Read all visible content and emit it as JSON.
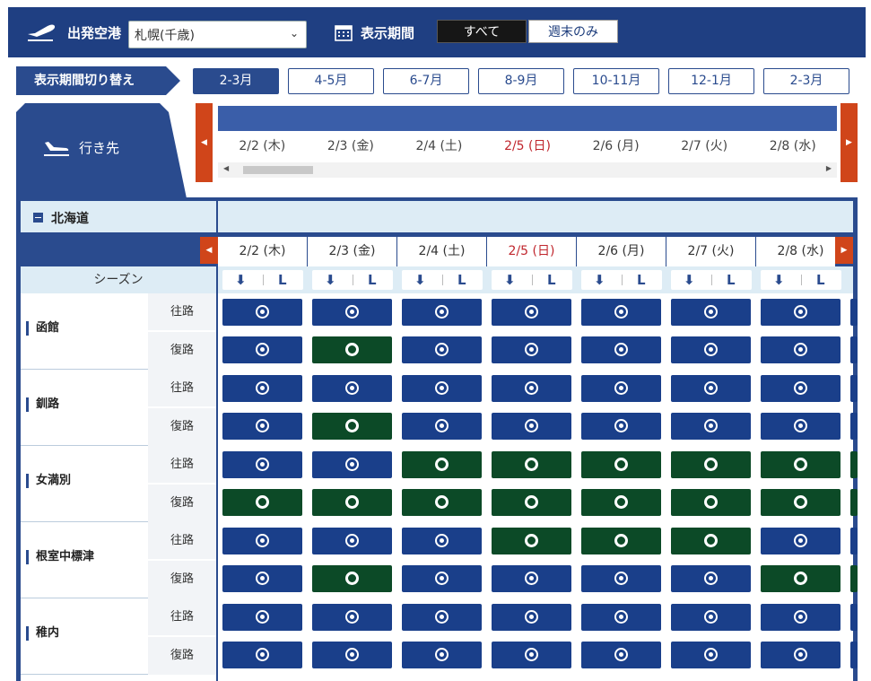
{
  "header": {
    "departure_label": "出発空港",
    "departure_value": "札幌(千歳)",
    "period_label": "表示期間",
    "btn_all": "すべて",
    "btn_weekend": "週末のみ"
  },
  "period_switch": {
    "label": "表示期間切り替え",
    "options": [
      "2-3月",
      "4-5月",
      "6-7月",
      "8-9月",
      "10-11月",
      "12-1月",
      "2-3月"
    ],
    "active_index": 0
  },
  "destination_header": "行き先",
  "dates": [
    {
      "label": "2/2 (木)",
      "sunday": false
    },
    {
      "label": "2/3 (金)",
      "sunday": false
    },
    {
      "label": "2/4 (土)",
      "sunday": false
    },
    {
      "label": "2/5 (日)",
      "sunday": true
    },
    {
      "label": "2/6 (月)",
      "sunday": false
    },
    {
      "label": "2/7 (火)",
      "sunday": false
    },
    {
      "label": "2/8 (水)",
      "sunday": false
    }
  ],
  "region": "北海道",
  "season_label": "シーズン",
  "fare_icons": {
    "down": "⬇",
    "l": "L"
  },
  "directions": {
    "out": "往路",
    "ret": "復路"
  },
  "colors": {
    "blue": "#1a3f8a",
    "green": "#0c4a27",
    "accent": "#d0451a"
  },
  "rows": [
    {
      "name": "函館",
      "out": [
        "b",
        "b",
        "b",
        "b",
        "b",
        "b",
        "b"
      ],
      "ret": [
        "b",
        "g",
        "b",
        "b",
        "b",
        "b",
        "b"
      ]
    },
    {
      "name": "釧路",
      "out": [
        "b",
        "b",
        "b",
        "b",
        "b",
        "b",
        "b"
      ],
      "ret": [
        "b",
        "g",
        "b",
        "b",
        "b",
        "b",
        "b"
      ]
    },
    {
      "name": "女満別",
      "out": [
        "b",
        "b",
        "g",
        "g",
        "g",
        "g",
        "g"
      ],
      "ret": [
        "g",
        "g",
        "g",
        "g",
        "g",
        "g",
        "g"
      ]
    },
    {
      "name": "根室中標津",
      "out": [
        "b",
        "b",
        "b",
        "g",
        "g",
        "g",
        "b"
      ],
      "ret": [
        "b",
        "g",
        "b",
        "b",
        "b",
        "b",
        "g"
      ]
    },
    {
      "name": "稚内",
      "out": [
        "b",
        "b",
        "b",
        "b",
        "b",
        "b",
        "b"
      ],
      "ret": [
        "b",
        "b",
        "b",
        "b",
        "b",
        "b",
        "b"
      ]
    }
  ]
}
